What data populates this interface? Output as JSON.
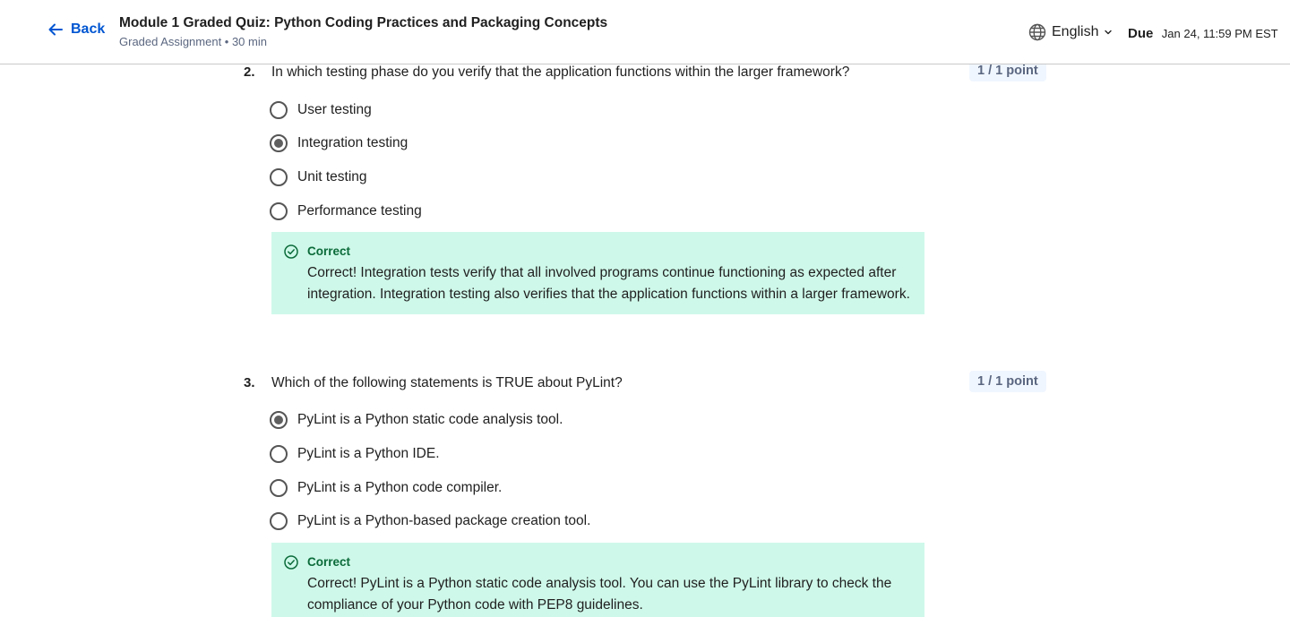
{
  "header": {
    "back_label": "Back",
    "title": "Module 1 Graded Quiz: Python Coding Practices and Packaging Concepts",
    "subtitle": "Graded Assignment • 30 min",
    "language": "English",
    "due_label": "Due",
    "due_date": "Jan 24, 11:59 PM EST"
  },
  "questions": [
    {
      "number": "2.",
      "text": "In which testing phase do you verify that the application functions within the larger framework?",
      "points": "1 / 1 point",
      "options": [
        {
          "label": "User testing",
          "selected": false
        },
        {
          "label": "Integration testing",
          "selected": true
        },
        {
          "label": "Unit testing",
          "selected": false
        },
        {
          "label": "Performance testing",
          "selected": false
        }
      ],
      "feedback": {
        "status": "Correct",
        "text": "Correct! Integration tests verify that all involved programs continue functioning as expected after integration. Integration testing also verifies that the application functions within a larger framework."
      }
    },
    {
      "number": "3.",
      "text": "Which of the following statements is TRUE about PyLint?",
      "points": "1 / 1 point",
      "options": [
        {
          "label": "PyLint is a Python static code analysis tool.",
          "selected": true
        },
        {
          "label": "PyLint is a Python IDE.",
          "selected": false
        },
        {
          "label": "PyLint is a Python code compiler.",
          "selected": false
        },
        {
          "label": "PyLint is a Python-based package creation tool.",
          "selected": false
        }
      ],
      "feedback": {
        "status": "Correct",
        "text": "Correct! PyLint is a Python static code analysis tool. You can use the PyLint library to check the compliance of your Python code with PEP8 guidelines."
      }
    }
  ],
  "icons": {
    "back": "arrow-left-icon",
    "language": "globe-icon",
    "dropdown": "chevron-down-icon",
    "feedback": "check-circle-icon"
  },
  "colors": {
    "accent": "#0056d2",
    "correct_bg": "#cef8e9",
    "correct_text": "#0b6b3a",
    "points_bg": "#f0f6ff"
  }
}
